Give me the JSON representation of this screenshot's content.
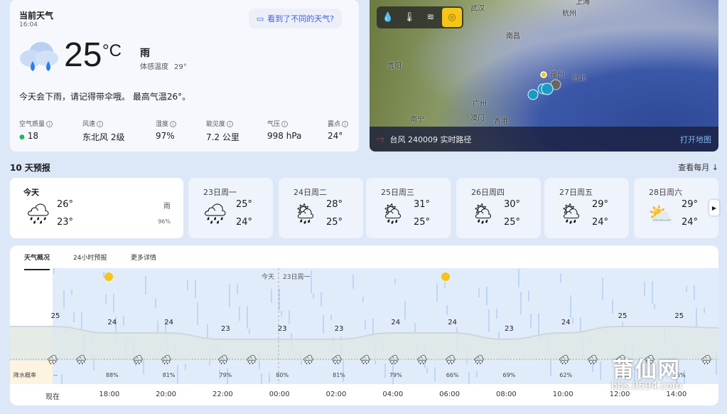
{
  "current": {
    "title": "当前天气",
    "time": "16:04",
    "feedback": "看到了不同的天气?",
    "temp": "25",
    "unit": "°C",
    "condition": "雨",
    "feels_label": "体感温度",
    "feels_value": "29°",
    "summary": "今天会下雨，请记得带伞哦。 最高气温26°。",
    "stats": [
      {
        "label": "空气质量",
        "value": "18",
        "dot": "#1db954"
      },
      {
        "label": "风速",
        "value": "东北风 2级"
      },
      {
        "label": "湿度",
        "value": "97%"
      },
      {
        "label": "能见度",
        "value": "7.2 公里"
      },
      {
        "label": "气压",
        "value": "998 hPa"
      },
      {
        "label": "露点",
        "value": "24°"
      }
    ]
  },
  "map": {
    "cities": [
      "武汉",
      "杭州",
      "南昌",
      "贵阳",
      "福州",
      "台北",
      "广州",
      "南宁",
      "澳门",
      "香港",
      "上海"
    ],
    "tools": [
      "precipitation-icon",
      "temperature-icon",
      "wind-icon",
      "typhoon-icon"
    ],
    "active_tool": "typhoon-icon",
    "typhoon_label": "台风 240009 实时路径",
    "open_map": "打开地图"
  },
  "forecast": {
    "title": "10 天预报",
    "monthly": "查看每月 ↓",
    "days": [
      {
        "date": "今天",
        "hi": "26°",
        "lo": "23°",
        "cond": "雨",
        "precip": "96%",
        "icon": "rain"
      },
      {
        "date": "23日周一",
        "hi": "25°",
        "lo": "24°",
        "icon": "rain"
      },
      {
        "date": "24日周二",
        "hi": "28°",
        "lo": "25°",
        "icon": "partly-cloudy-rain"
      },
      {
        "date": "25日周三",
        "hi": "31°",
        "lo": "25°",
        "icon": "partly-cloudy-rain"
      },
      {
        "date": "26日周四",
        "hi": "30°",
        "lo": "25°",
        "icon": "partly-cloudy-rain"
      },
      {
        "date": "27日周五",
        "hi": "29°",
        "lo": "24°",
        "icon": "partly-cloudy-rain"
      },
      {
        "date": "28日周六",
        "hi": "29°",
        "lo": "24°",
        "icon": "partly-cloudy"
      }
    ]
  },
  "hourly": {
    "tabs": [
      "天气概况",
      "24小时预报",
      "更多详情"
    ],
    "today_label": "今天",
    "next_day_label": "23日周一",
    "precip_label": "降水概率",
    "times": [
      "现在",
      "18:00",
      "20:00",
      "22:00",
      "00:00",
      "02:00",
      "04:00",
      "06:00",
      "08:00",
      "10:00",
      "12:00",
      "14:00"
    ],
    "temps": [
      25,
      24,
      24,
      23,
      23,
      23,
      24,
      24,
      23,
      24,
      25,
      25
    ],
    "precip": [
      "--",
      "88%",
      "81%",
      "79%",
      "80%",
      "81%",
      "79%",
      "66%",
      "69%",
      "62%",
      "50%",
      "55%"
    ]
  },
  "watermark": {
    "name": "莆仙网",
    "url": "bbs.0594.com"
  }
}
